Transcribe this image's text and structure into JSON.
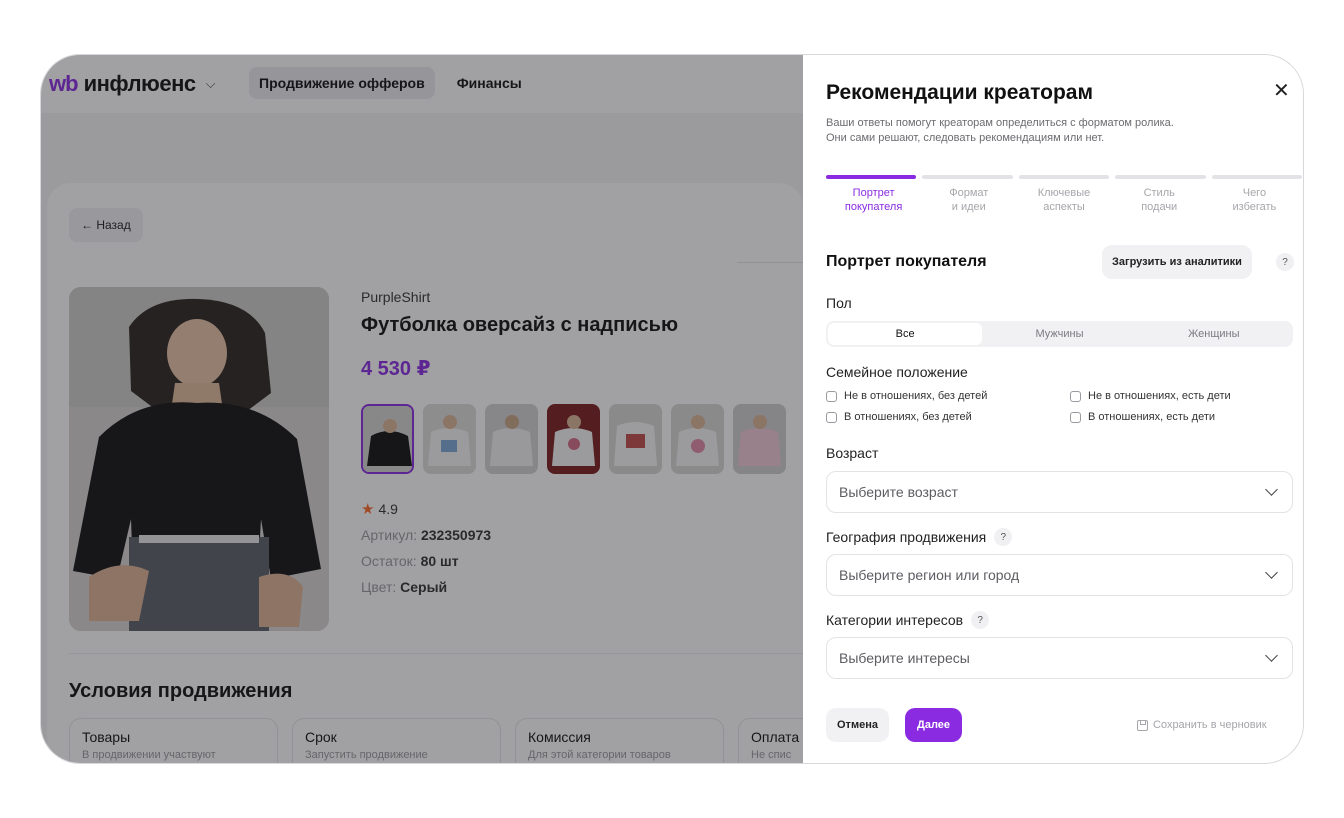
{
  "app": {
    "logo_wb": "wb",
    "logo_name": "инфлюенс",
    "nav": [
      "Продвижение офферов",
      "Финансы"
    ],
    "back_label": "← Назад",
    "product": {
      "brand": "PurpleShirt",
      "title": "Футболка оверсайз с надписью",
      "price": "4 530 ₽",
      "rating": "4.9",
      "article_label": "Артикул:",
      "article_value": "232350973",
      "stock_label": "Остаток:",
      "stock_value": "80 шт",
      "color_label": "Цвет:",
      "color_value": "Серый"
    },
    "conditions_title": "Условия продвижения",
    "conditions": [
      {
        "title": "Товары",
        "sub": "В продвижении участвуют"
      },
      {
        "title": "Срок",
        "sub": "Запустить продвижение"
      },
      {
        "title": "Комиссия",
        "sub": "Для этой категории товаров"
      },
      {
        "title": "Оплата",
        "sub": "Не спис"
      }
    ]
  },
  "drawer": {
    "title": "Рекомендации креаторам",
    "subtitle_1": "Ваши ответы помогут креаторам определиться с форматом ролика.",
    "subtitle_2": "Они сами решают, следовать рекомендациям или нет.",
    "steps": [
      {
        "l1": "Портрет",
        "l2": "покупателя"
      },
      {
        "l1": "Формат",
        "l2": "и идеи"
      },
      {
        "l1": "Ключевые",
        "l2": "аспекты"
      },
      {
        "l1": "Стиль",
        "l2": "подачи"
      },
      {
        "l1": "Чего",
        "l2": "избегать"
      }
    ],
    "section_title": "Портрет покупателя",
    "load_button": "Загрузить из аналитики",
    "help": "?",
    "gender_label": "Пол",
    "gender_options": [
      "Все",
      "Мужчины",
      "Женщины"
    ],
    "family_label": "Семейное положение",
    "family_options": [
      "Не в отношениях, без детей",
      "Не в отношениях, есть дети",
      "В отношениях, без детей",
      "В отношениях, есть дети"
    ],
    "age_label": "Возраст",
    "age_placeholder": "Выберите возраст",
    "geo_label": "География продвижения",
    "geo_placeholder": "Выберите регион или город",
    "interests_label": "Категории интересов",
    "interests_placeholder": "Выберите интересы",
    "cancel": "Отмена",
    "next": "Далее",
    "save_draft": "Сохранить в черновик"
  },
  "colors": {
    "accent": "#8a2be2",
    "star": "#ff6a2b"
  }
}
